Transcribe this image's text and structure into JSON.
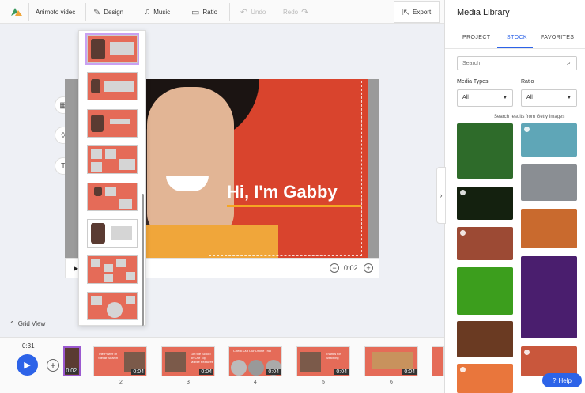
{
  "toolbar": {
    "project_name": "Animoto videc",
    "design": "Design",
    "music": "Music",
    "ratio": "Ratio",
    "undo": "Undo",
    "redo": "Redo",
    "export": "Export"
  },
  "preview": {
    "headline": "Hi, I'm Gabby",
    "time": "0:02"
  },
  "grid_view": "Grid View",
  "timeline": {
    "current_time": "0:31",
    "scenes": [
      {
        "duration": "0:02",
        "number": ""
      },
      {
        "duration": "0:04",
        "number": "2",
        "text": "The Power of Stellar Search"
      },
      {
        "duration": "0:04",
        "number": "3",
        "text": "Get the Scoop on Our Top Mobile Features"
      },
      {
        "duration": "0:04",
        "number": "4",
        "text": "Check Out Our Online Trial"
      },
      {
        "duration": "0:04",
        "number": "5",
        "text": "Thanks for Watching"
      },
      {
        "duration": "0:04",
        "number": "6",
        "text": ""
      }
    ]
  },
  "sidebar": {
    "title": "Media Library",
    "tabs": [
      "PROJECT",
      "STOCK",
      "FAVORITES"
    ],
    "active_tab": "STOCK",
    "search_placeholder": "Search",
    "media_types_label": "Media Types",
    "media_types_value": "All",
    "ratio_label": "Ratio",
    "ratio_value": "All",
    "results_label": "Search results from Getty Images"
  },
  "help": "Help",
  "colors": {
    "accent": "#2d63e8",
    "brand_red": "#d9442d",
    "selection": "#9b59d0"
  }
}
